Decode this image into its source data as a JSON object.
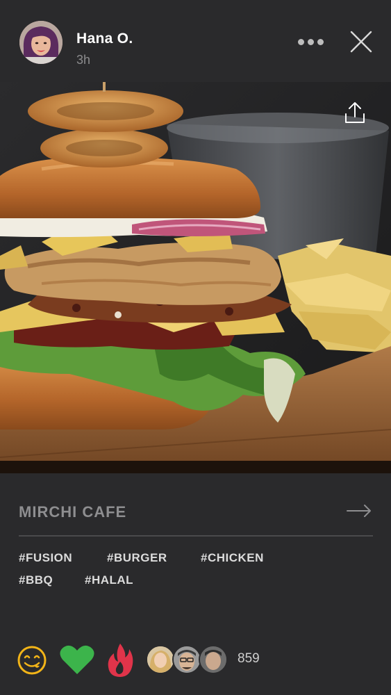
{
  "post": {
    "author": "Hana O.",
    "time": "3h",
    "place": "MIRCHI CAFE",
    "tags": [
      "#FUSION",
      "#BURGER",
      "#CHICKEN",
      "#BBQ",
      "#HALAL"
    ],
    "like_count": "859"
  },
  "icons": {
    "more": "more-dots-icon",
    "close": "close-icon",
    "share": "share-upload-icon",
    "arrow": "arrow-right-icon",
    "yum": "yum-face-icon",
    "heart": "heart-icon",
    "fire": "fire-icon"
  },
  "colors": {
    "background": "#2a2a2c",
    "heart": "#3cb44b",
    "fire": "#e0344a",
    "yum": "#f2b418",
    "place_text": "#8e8e90"
  }
}
